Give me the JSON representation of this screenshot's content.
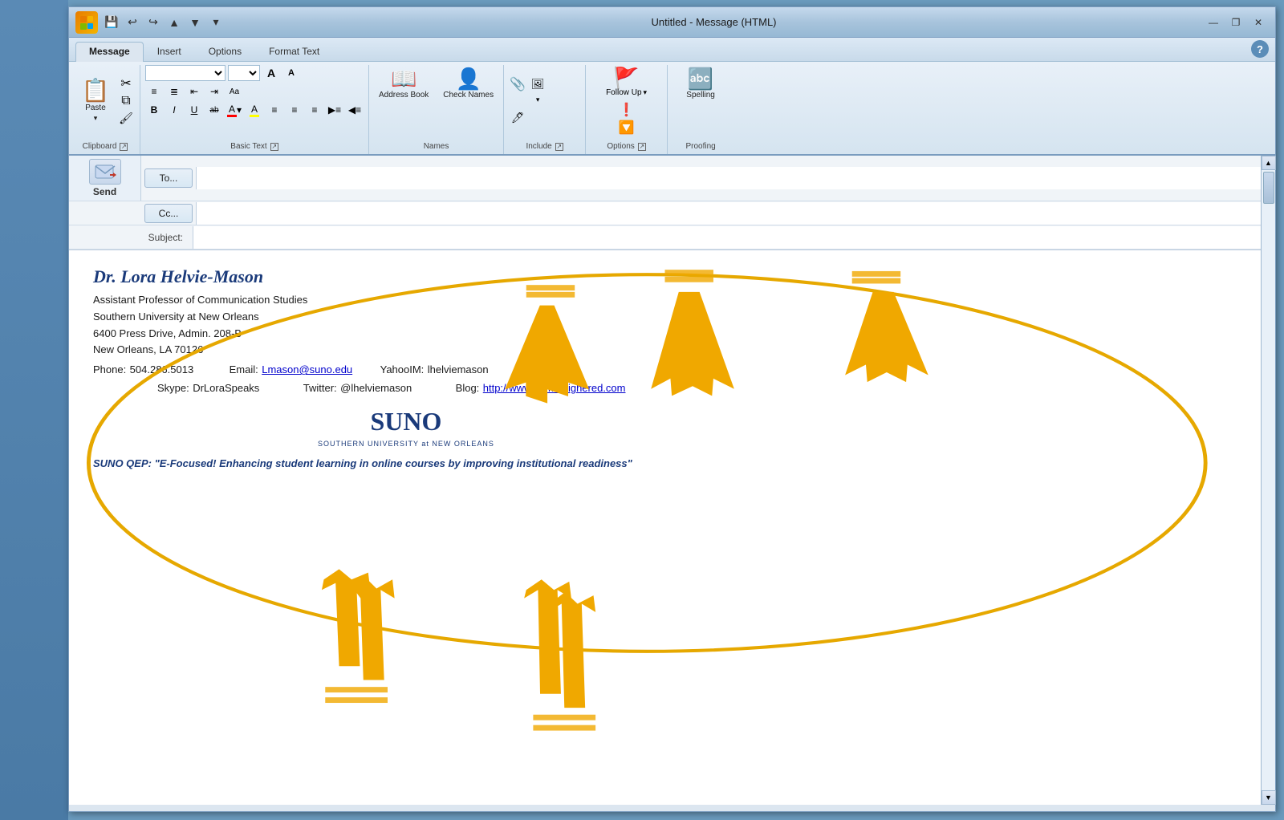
{
  "window": {
    "title": "Untitled - Message (HTML)",
    "minimize": "—",
    "restore": "❐",
    "close": "✕"
  },
  "ribbon": {
    "tabs": [
      "Message",
      "Insert",
      "Options",
      "Format Text"
    ],
    "active_tab": "Message",
    "groups": {
      "clipboard": {
        "label": "Clipboard",
        "paste": "Paste",
        "cut": "✂",
        "copy": "⧉",
        "format_painter": "🖌"
      },
      "basic_text": {
        "label": "Basic Text",
        "font_name": "",
        "font_size": "",
        "bold": "B",
        "italic": "I",
        "underline": "U",
        "strikethrough": "ab",
        "font_color": "A"
      },
      "names": {
        "label": "Names",
        "address_book": "Address Book",
        "check_names": "Check Names"
      },
      "include": {
        "label": "Include"
      },
      "options": {
        "label": "Options"
      },
      "proofing": {
        "label": "Proofing",
        "spelling": "Spelling"
      }
    }
  },
  "compose": {
    "to_label": "To...",
    "cc_label": "Cc...",
    "subject_label": "Subject:",
    "send_label": "Send",
    "to_value": "",
    "cc_value": "",
    "subject_value": ""
  },
  "signature": {
    "name": "Dr. Lora Helvie-Mason",
    "title": "Assistant Professor of Communication Studies",
    "university": "Southern University at New Orleans",
    "address": "6400 Press Drive, Admin. 208-B",
    "city": "New Orleans, LA 70126",
    "phone_label": "Phone:",
    "phone": "504.286.5013",
    "email_label": "Email:",
    "email": "Lmason@suno.edu",
    "yahooim_label": "YahooIM:",
    "yahooim": "lhelviemason",
    "skype_label": "Skype:",
    "skype": "DrLoraSpeaks",
    "twitter_label": "Twitter:",
    "twitter": "@lhelviemason",
    "blog_label": "Blog:",
    "blog": "http://www.commhighered.com",
    "logo_main": "SUNO",
    "logo_sub": "SOUTHERN UNIVERSITY at NEW ORLEANS",
    "qep": "SUNO QEP: \"E-Focused! Enhancing student learning in online courses by improving institutional readiness\""
  }
}
